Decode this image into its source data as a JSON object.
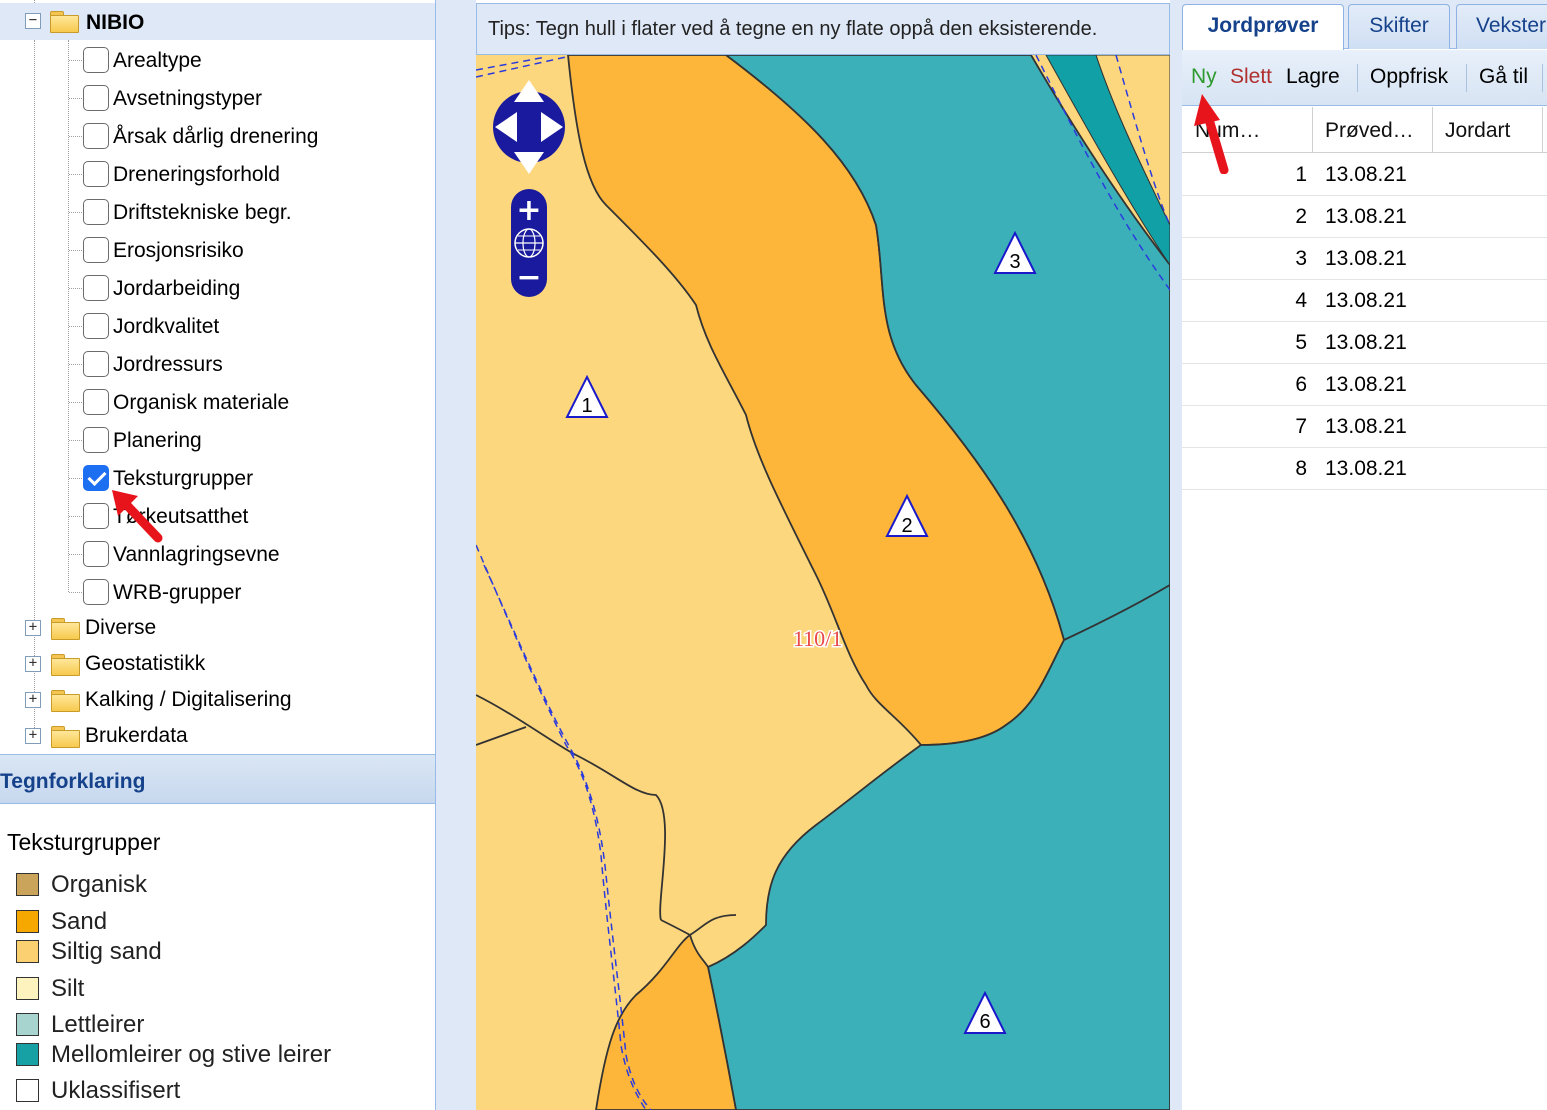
{
  "tree": {
    "root_label": "NIBIO",
    "root_expander": "−",
    "layers": [
      {
        "label": "Arealtype",
        "checked": false
      },
      {
        "label": "Avsetningstyper",
        "checked": false
      },
      {
        "label": "Årsak dårlig drenering",
        "checked": false
      },
      {
        "label": "Dreneringsforhold",
        "checked": false
      },
      {
        "label": "Driftstekniske begr.",
        "checked": false
      },
      {
        "label": "Erosjonsrisiko",
        "checked": false
      },
      {
        "label": "Jordarbeiding",
        "checked": false
      },
      {
        "label": "Jordkvalitet",
        "checked": false
      },
      {
        "label": "Jordressurs",
        "checked": false
      },
      {
        "label": "Organisk materiale",
        "checked": false
      },
      {
        "label": "Planering",
        "checked": false
      },
      {
        "label": "Teksturgrupper",
        "checked": true
      },
      {
        "label": "Tørkeutsatthet",
        "checked": false
      },
      {
        "label": "Vannlagringsevne",
        "checked": false
      },
      {
        "label": "WRB-grupper",
        "checked": false
      }
    ],
    "groups": [
      {
        "label": "Diverse",
        "expander": "+"
      },
      {
        "label": "Geostatistikk",
        "expander": "+"
      },
      {
        "label": "Kalking / Digitalisering",
        "expander": "+"
      },
      {
        "label": "Brukerdata",
        "expander": "+"
      }
    ]
  },
  "legend": {
    "header": "Tegnforklaring",
    "title": "Teksturgrupper",
    "items": [
      {
        "label": "Organisk",
        "color": "#c9a45a"
      },
      {
        "label": "Sand",
        "color": "#f6a800"
      },
      {
        "label": "Siltig sand",
        "color": "#fbd070"
      },
      {
        "label": "Silt",
        "color": "#fdf3bf"
      },
      {
        "label": "Lettleirer",
        "color": "#a8d4d0"
      },
      {
        "label": "Mellomleirer og stive leirer",
        "color": "#17a1a4"
      },
      {
        "label": "Uklassifisert",
        "color": "#ffffff"
      }
    ]
  },
  "tips": "Tips: Tegn hull i flater ved å tegne en ny flate oppå den eksisterende.",
  "map": {
    "colors": {
      "siltig_sand": "#fdd77d",
      "sand": "#fdb63a",
      "leire": "#3cb0b9",
      "leire_dark": "#11a0a6",
      "marker": "#1a1acc",
      "label": "#e84b4b"
    },
    "markers": [
      "1",
      "2",
      "3",
      "6"
    ],
    "parcel_label": "110/1",
    "zoom_in": "+",
    "zoom_out": "−"
  },
  "right": {
    "tabs": [
      "Jordprøver",
      "Skifter",
      "Vekster"
    ],
    "toolbar": {
      "new": "Ny",
      "delete": "Slett",
      "save": "Lagre",
      "refresh": "Oppfrisk",
      "goto": "Gå til",
      "new_color": "#2e9a2e",
      "delete_color": "#b03030"
    },
    "columns": [
      "Num…",
      "Prøved…",
      "Jordart"
    ],
    "rows": [
      {
        "num": "1",
        "date": "13.08.21"
      },
      {
        "num": "2",
        "date": "13.08.21"
      },
      {
        "num": "3",
        "date": "13.08.21"
      },
      {
        "num": "4",
        "date": "13.08.21"
      },
      {
        "num": "5",
        "date": "13.08.21"
      },
      {
        "num": "6",
        "date": "13.08.21"
      },
      {
        "num": "7",
        "date": "13.08.21"
      },
      {
        "num": "8",
        "date": "13.08.21"
      }
    ]
  }
}
